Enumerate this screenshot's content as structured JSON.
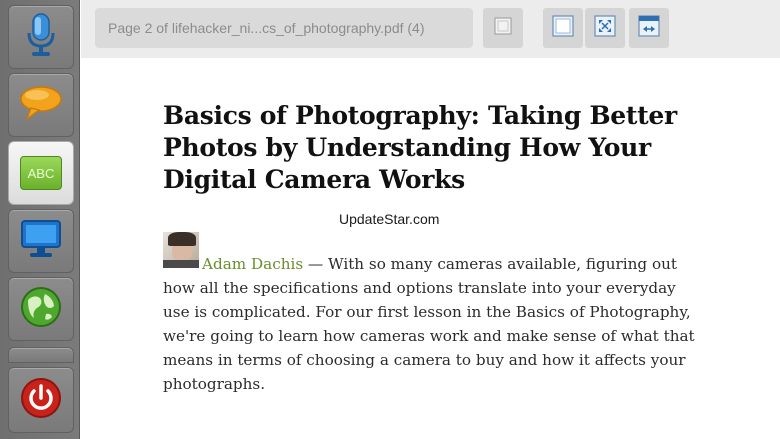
{
  "toolbar": {
    "document_title": "Page 2 of lifehacker_ni...cs_of_photography.pdf (4)"
  },
  "sidebar": {
    "items": [
      {
        "icon": "microphone-icon"
      },
      {
        "icon": "speech-bubble-icon"
      },
      {
        "icon": "abc-icon",
        "label": "ABC"
      },
      {
        "icon": "monitor-icon"
      },
      {
        "icon": "globe-icon"
      },
      {
        "icon": "power-icon"
      }
    ]
  },
  "article": {
    "title": "Basics of Photography: Taking Better Photos by Understanding How Your Digital Camera Works",
    "watermark": "UpdateStar.com",
    "author": "Adam Dachis",
    "body": " — With so many cameras available, figuring out how all the specifications and options translate into your everyday use is complicated. For our first lesson in the Basics of Photography, we're going to learn how cameras work and make sense of what that means in terms of choosing a camera to buy and how it affects your photographs."
  },
  "colors": {
    "sidebar": "#757575",
    "toolbar": "#ececec",
    "author_link": "#6a8e2b"
  }
}
